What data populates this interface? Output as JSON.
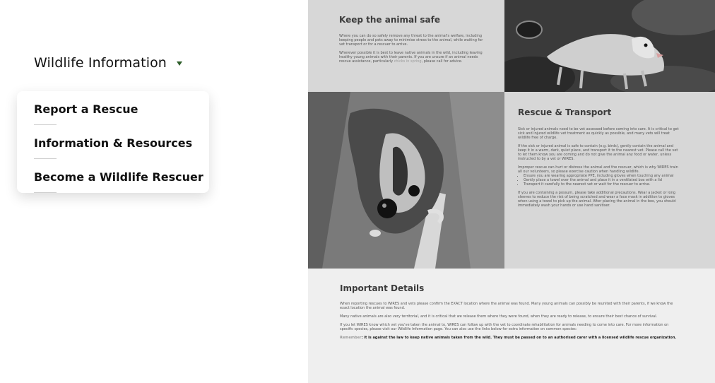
{
  "nav": {
    "title": "Wildlife Information",
    "dropdown": [
      "Report a Rescue",
      "Information & Resources",
      "Become a Wildlife Rescuer"
    ]
  },
  "sections": {
    "keep_safe": {
      "title": "Keep the animal safe",
      "p1": "Where you can do so safely remove any threat to the animal's welfare, including keeping people and pets away to minimise stress to the animal, while waiting for vet transport or for a rescuer to arrive.",
      "p2_a": "Wherever possible it is best to leave native animals in the wild, including leaving healthy young animals with their parents. If you are unsure if an animal needs rescue assistance, particularly",
      "p2_link": "chicks in spring",
      "p2_b": ", please call for advice."
    },
    "rescue_transport": {
      "title": "Rescue & Transport",
      "p1": "Sick or injured animals need to be vet assessed before coming into care. It is critical to get sick and injured wildlife vet treatment as quickly as possible, and many vets will treat wildlife free of charge.",
      "p2": "If the sick or injured animal is safe to contain (e.g. birds), gently contain the animal and keep it in a warm, dark, quiet place, and transport it to the nearest vet. Please call the vet to let them know you are coming and do not give the animal any food or water, unless instructed to by a vet or WIRES.",
      "p3": "Improper rescue can hurt or distress the animal and the rescuer, which is why WIRES train all our volunteers, so please exercise caution when handling wildlife.",
      "bullets": [
        "Ensure you are wearing appropriate PPE, including gloves when touching any animal",
        "Gently place a towel over the animal and place it in a ventilated box with a lid",
        "Transport it carefully to the nearest vet or wait for the rescuer to arrive."
      ],
      "p4": "If you are containing a possum, please take additional precautions. Wear a jacket or long sleeves to reduce the risk of being scratched and wear a face mask in addition to gloves when using a towel to pick up the animal. After placing the animal in the box, you should immediately wash your hands or use hand sanitiser."
    },
    "important": {
      "title": "Important Details",
      "p1": "When reporting rescues to WIRES and vets please confirm the EXACT location where the animal was found. Many young animals can possibly be reunited with their parents, if we know the exact location the animal was found.",
      "p2": "Many native animals are also very territorial, and it is critical that we release them where they were found, when they are ready to release, to ensure their best chance of survival.",
      "p3": "If you let WIRES know which vet you've taken the animal to, WIRES can follow up with the vet to coordinate rehabilitation for animals needing to come into care. For more information on specific species, please visit our Wildlife Information page. You can also use the links below for extra information on common species:",
      "remember_label": "Remember",
      "remember_text": ": it is against the law to keep native animals taken from the wild. They must be passed on to an authorised carer with a licensed wildlife rescue organization."
    }
  }
}
